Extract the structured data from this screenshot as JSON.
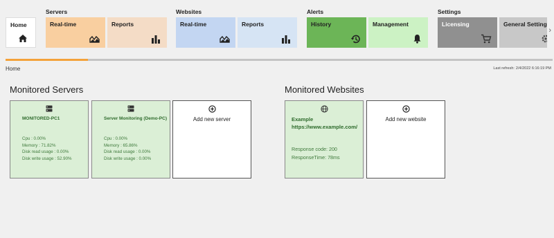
{
  "nav": {
    "home": {
      "label": "Home",
      "icon": "home-icon"
    },
    "groups": [
      {
        "label": "Servers",
        "tiles": [
          {
            "label": "Real-time",
            "icon": "area-chart-icon",
            "color": "#f9cfa0"
          },
          {
            "label": "Reports",
            "icon": "bar-chart-icon",
            "color": "#f4dcc6"
          }
        ]
      },
      {
        "label": "Websites",
        "tiles": [
          {
            "label": "Real-time",
            "icon": "area-chart-icon",
            "color": "#c3d6f2"
          },
          {
            "label": "Reports",
            "icon": "bar-chart-icon",
            "color": "#d6e4f4"
          }
        ]
      },
      {
        "label": "Alerts",
        "tiles": [
          {
            "label": "History",
            "icon": "history-icon",
            "color": "#6cb557"
          },
          {
            "label": "Management",
            "icon": "bell-icon",
            "color": "#ccf2c4"
          }
        ]
      },
      {
        "label": "Settings",
        "tiles": [
          {
            "label": "Licensing",
            "icon": "cart-icon",
            "color": "#909090"
          },
          {
            "label": "General Settings",
            "icon": "gear-icon",
            "color": "#c8c8c8"
          }
        ]
      }
    ],
    "scroll_arrow": "›"
  },
  "progress": {
    "fraction": 0.15,
    "color": "#f4a23a"
  },
  "breadcrumb": "Home",
  "last_refresh": {
    "label": "Last refresh:",
    "value": "2/4/2022 6:16:19 PM"
  },
  "servers": {
    "title": "Monitored Servers",
    "cards": [
      {
        "name": "MONITORED-PC1",
        "cpu": "Cpu : 0.00%",
        "memory": "Memory : 71.82%",
        "disk_read": "Disk read usage : 0.00%",
        "disk_write": "Disk write usage : 52.90%"
      },
      {
        "name": "Server Monitoring (Demo-PC)",
        "cpu": "Cpu : 0.00%",
        "memory": "Memory : 65.86%",
        "disk_read": "Disk read usage : 0.00%",
        "disk_write": "Disk write usage : 0.00%"
      }
    ],
    "add_label": "Add new server"
  },
  "websites": {
    "title": "Monitored Websites",
    "cards": [
      {
        "name": "Example https://www.example.com/",
        "response_code": "Response code: 200",
        "response_time": "ResponseTime: 78ms"
      }
    ],
    "add_label": "Add new website"
  },
  "colors": {
    "card_ok_bg": "#dbefd6",
    "card_ok_text": "#2e6b2c",
    "accent": "#f4a23a"
  }
}
